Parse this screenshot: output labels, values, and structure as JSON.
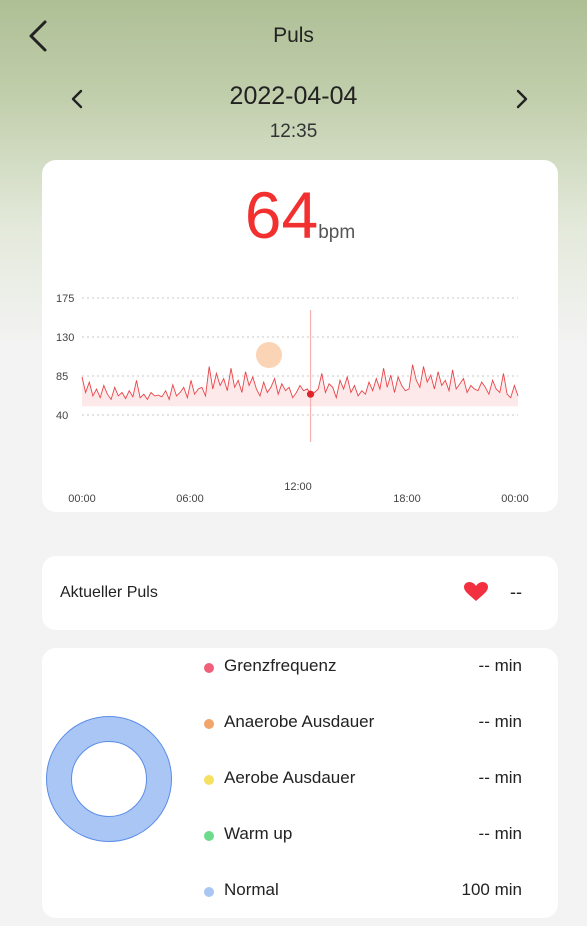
{
  "header": {
    "title": "Puls",
    "back_icon": "chevron-left-icon"
  },
  "date_nav": {
    "date": "2022-04-04",
    "time": "12:35",
    "prev_icon": "chevron-left-icon",
    "next_icon": "chevron-right-icon"
  },
  "summary": {
    "value": "64",
    "unit": "bpm"
  },
  "colors": {
    "accent_red": "#f23030",
    "line": "#e8454a",
    "fill": "#fde3e3",
    "grid": "#c8c8c8",
    "scrubber": "#fbd4b6",
    "ring": "#a9c6f4",
    "ring_stroke": "#5b8de8"
  },
  "chart_data": {
    "type": "area",
    "yticks": [
      175,
      130,
      85,
      40
    ],
    "xticks": [
      "00:00",
      "06:00",
      "12:00",
      "18:00",
      "00:00"
    ],
    "ylim": [
      40,
      175
    ],
    "xlim": [
      0,
      24
    ],
    "grid": true,
    "selected": {
      "x": 12.58,
      "y": 64
    },
    "x": [
      0,
      0.2,
      0.4,
      0.6,
      0.8,
      1,
      1.2,
      1.4,
      1.6,
      1.8,
      2,
      2.2,
      2.4,
      2.6,
      2.8,
      3,
      3.2,
      3.4,
      3.6,
      3.8,
      4,
      4.2,
      4.4,
      4.6,
      4.8,
      5,
      5.2,
      5.4,
      5.6,
      5.8,
      6,
      6.2,
      6.4,
      6.6,
      6.8,
      7,
      7.2,
      7.4,
      7.6,
      7.8,
      8,
      8.2,
      8.4,
      8.6,
      8.8,
      9,
      9.2,
      9.4,
      9.6,
      9.8,
      10,
      10.2,
      10.4,
      10.6,
      10.8,
      11,
      11.2,
      11.4,
      11.6,
      11.8,
      12,
      12.2,
      12.4,
      12.6,
      12.8,
      13,
      13.2,
      13.4,
      13.6,
      13.8,
      14,
      14.2,
      14.4,
      14.6,
      14.8,
      15,
      15.2,
      15.4,
      15.6,
      15.8,
      16,
      16.2,
      16.4,
      16.6,
      16.8,
      17,
      17.2,
      17.4,
      17.6,
      17.8,
      18,
      18.2,
      18.4,
      18.6,
      18.8,
      19,
      19.2,
      19.4,
      19.6,
      19.8,
      20,
      20.2,
      20.4,
      20.6,
      20.8,
      21,
      21.2,
      21.4,
      21.6,
      21.8,
      22,
      22.2,
      22.4,
      22.6,
      22.8,
      23,
      23.2,
      23.4,
      23.6,
      23.8,
      24
    ],
    "values": [
      84,
      66,
      78,
      62,
      70,
      60,
      74,
      64,
      58,
      72,
      62,
      66,
      59,
      68,
      61,
      80,
      60,
      64,
      58,
      66,
      62,
      63,
      61,
      68,
      58,
      75,
      62,
      66,
      72,
      60,
      80,
      64,
      70,
      72,
      62,
      96,
      70,
      88,
      74,
      82,
      68,
      94,
      72,
      80,
      66,
      90,
      74,
      84,
      70,
      62,
      78,
      66,
      72,
      82,
      64,
      76,
      68,
      72,
      60,
      66,
      74,
      68,
      70,
      64,
      66,
      70,
      88,
      66,
      76,
      72,
      60,
      80,
      70,
      84,
      66,
      74,
      62,
      68,
      64,
      78,
      68,
      82,
      70,
      94,
      72,
      86,
      66,
      84,
      74,
      68,
      70,
      98,
      80,
      72,
      96,
      78,
      86,
      70,
      90,
      74,
      80,
      68,
      92,
      70,
      76,
      82,
      66,
      74,
      70,
      68,
      78,
      72,
      64,
      80,
      70,
      66,
      88,
      64,
      60,
      74,
      62
    ]
  },
  "current": {
    "label": "Aktueller Puls",
    "value": "--",
    "icon": "heart-icon"
  },
  "zones": [
    {
      "label": "Grenzfrequenz",
      "value": "-- min",
      "color": "#f0607a"
    },
    {
      "label": "Anaerobe Ausdauer",
      "value": "-- min",
      "color": "#f2a56a"
    },
    {
      "label": "Aerobe Ausdauer",
      "value": "-- min",
      "color": "#f5e060"
    },
    {
      "label": "Warm up",
      "value": "-- min",
      "color": "#6cdc8c"
    },
    {
      "label": "Normal",
      "value": "100 min",
      "color": "#a9c6f4"
    }
  ]
}
